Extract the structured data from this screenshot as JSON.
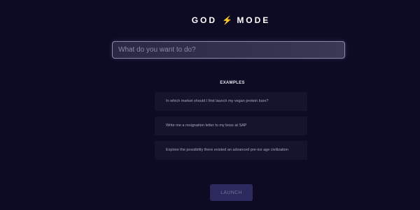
{
  "header": {
    "title_left": "GOD",
    "title_icon": "lightning-bolt-icon",
    "title_right": "MODE",
    "icon_color": "#f5b820"
  },
  "prompt": {
    "placeholder": "What do you want to do?",
    "value": ""
  },
  "examples": {
    "heading": "EXAMPLES",
    "items": [
      "In which market should I first launch my vegan protein bars?",
      "Write me a resignation letter to my boss at SAP",
      "Explore the possibility there existed an advanced pre-ice age civilization"
    ]
  },
  "launch": {
    "label": "LAUNCH",
    "state": "disabled"
  },
  "colors": {
    "background": "#0d0b24",
    "card": "#15142c",
    "button": "#2c2a5c"
  }
}
